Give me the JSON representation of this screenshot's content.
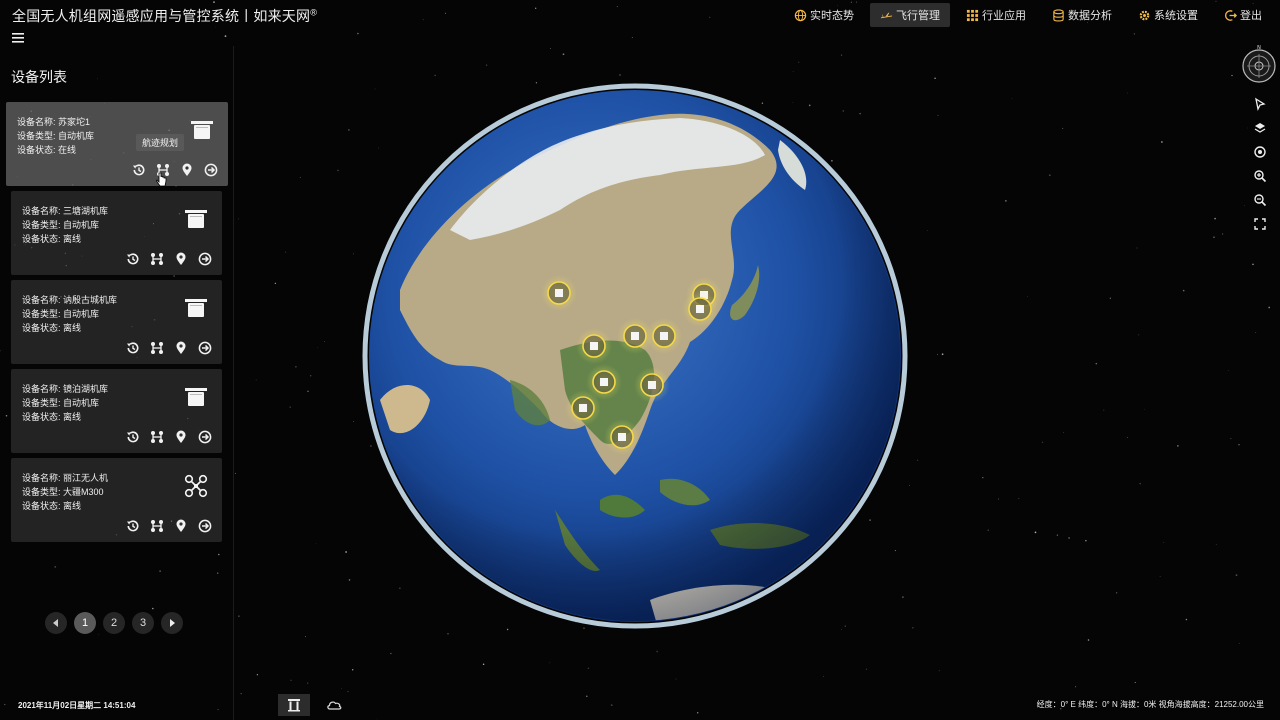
{
  "app": {
    "title": "全国无人机组网遥感应用与管控系统丨如来天网",
    "title_mark": "®"
  },
  "nav": [
    {
      "label": "实时态势",
      "icon": "globe-icon",
      "active": false
    },
    {
      "label": "飞行管理",
      "icon": "plane-icon",
      "active": true
    },
    {
      "label": "行业应用",
      "icon": "grid-icon",
      "active": false
    },
    {
      "label": "数据分析",
      "icon": "database-icon",
      "active": false
    },
    {
      "label": "系统设置",
      "icon": "gear-icon",
      "active": false
    },
    {
      "label": "登出",
      "icon": "logout-icon",
      "active": false
    }
  ],
  "sidebar": {
    "title": "设备列表",
    "name_label": "设备名称: ",
    "type_label": "设备类型: ",
    "status_label": "设备状态: ",
    "tooltip": "航迹规划",
    "devices": [
      {
        "name": "苏家坨1",
        "type": "自动机库",
        "status": "在线",
        "icon": "hangar-icon"
      },
      {
        "name": "三塘湖机库",
        "type": "自动机库",
        "status": "离线",
        "icon": "hangar-icon"
      },
      {
        "name": "讷殷古城机库",
        "type": "自动机库",
        "status": "离线",
        "icon": "hangar-icon"
      },
      {
        "name": "镜泊湖机库",
        "type": "自动机库",
        "status": "离线",
        "icon": "hangar-icon"
      },
      {
        "name": "丽江无人机",
        "type": "大疆M300",
        "status": "离线",
        "icon": "drone-icon"
      }
    ],
    "pagination": {
      "pages": [
        "1",
        "2",
        "3"
      ],
      "current": "1"
    }
  },
  "footer": {
    "datetime": "2021年11月02日星期二 14:51:04",
    "coords": "经度：0° E 纬度：0° N 海拔：0米 视角海拔高度：21252.00公里"
  },
  "colors": {
    "accent_gold": "#f5d94a",
    "ocean": "#1e4fa3",
    "atmosphere": "#bfe3ff"
  }
}
